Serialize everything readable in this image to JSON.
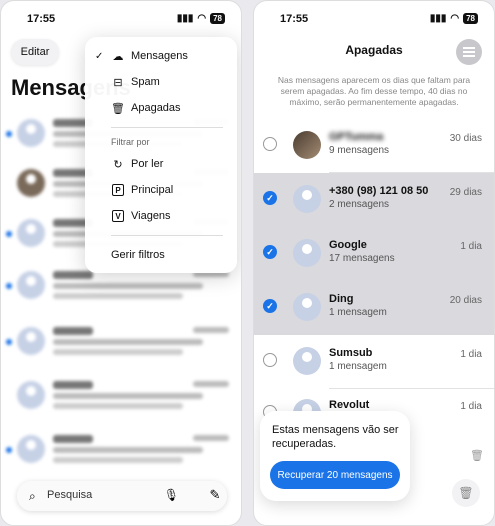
{
  "status": {
    "time": "17:55",
    "battery": "78"
  },
  "left": {
    "edit_label": "Editar",
    "title": "Mensagens",
    "menu": {
      "items": [
        {
          "label": "Mensagens",
          "checked": true,
          "icon": "cloud-bubble-icon"
        },
        {
          "label": "Spam",
          "checked": false,
          "icon": "spam-box-icon"
        },
        {
          "label": "Apagadas",
          "checked": false,
          "icon": "trash-icon"
        }
      ],
      "filter_header": "Filtrar por",
      "filters": [
        {
          "label": "Por ler",
          "icon": "unread-icon"
        },
        {
          "label": "Principal",
          "icon": "P"
        },
        {
          "label": "Viagens",
          "icon": "V"
        }
      ],
      "manage_label": "Gerir filtros"
    },
    "search_placeholder": "Pesquisa"
  },
  "right": {
    "title": "Apagadas",
    "info": "Nas mensagens aparecem os dias que faltam para serem apagadas. Ao fim desse tempo, 40 dias no máximo, serão permanentemente apagadas.",
    "rows": [
      {
        "name": "GPTumma",
        "count": "9 mensagens",
        "days": "30 dias",
        "selected": false,
        "photo": true,
        "blur": true
      },
      {
        "name": "+380 (98) 121 08 50",
        "count": "2 mensagens",
        "days": "29 dias",
        "selected": true,
        "photo": false,
        "blur": false
      },
      {
        "name": "Google",
        "count": "17 mensagens",
        "days": "1 dia",
        "selected": true,
        "photo": false,
        "blur": false
      },
      {
        "name": "Ding",
        "count": "1 mensagem",
        "days": "20 dias",
        "selected": true,
        "photo": false,
        "blur": false
      },
      {
        "name": "Sumsub",
        "count": "1 mensagem",
        "days": "1 dia",
        "selected": false,
        "photo": false,
        "blur": false
      },
      {
        "name": "Revolut",
        "count": "",
        "days": "1 dia",
        "selected": false,
        "photo": false,
        "blur": false
      }
    ],
    "toast_text": "Estas mensagens vão ser recuperadas.",
    "recover_label": "Recuperar 20 mensagens"
  }
}
